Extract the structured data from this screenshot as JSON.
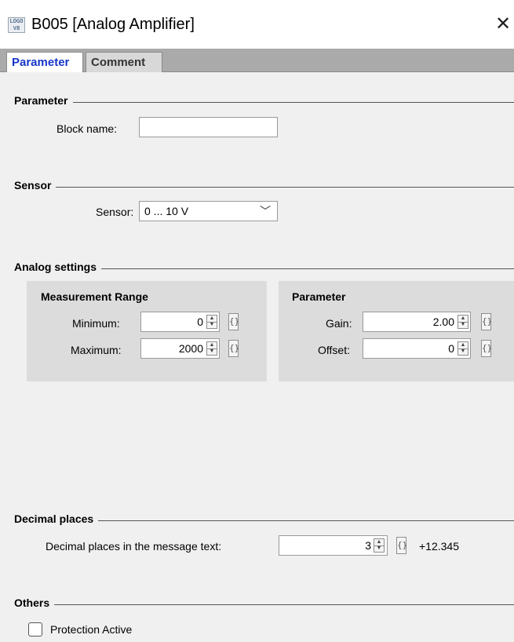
{
  "window": {
    "title": "B005 [Analog Amplifier]",
    "app_icon_text": "LOGO V8",
    "close_glyph": "✕"
  },
  "tabs": [
    {
      "label": "Parameter",
      "active": true
    },
    {
      "label": "Comment",
      "active": false
    }
  ],
  "sections": {
    "parameter": {
      "title": "Parameter",
      "block_name_label": "Block name:",
      "block_name_value": ""
    },
    "sensor": {
      "title": "Sensor",
      "sensor_label": "Sensor:",
      "sensor_value": "0 ... 10 V",
      "chevron": "﹀"
    },
    "analog_settings": {
      "title": "Analog settings",
      "measurement_range": {
        "title": "Measurement Range",
        "minimum_label": "Minimum:",
        "minimum_value": "0",
        "maximum_label": "Maximum:",
        "maximum_value": "2000"
      },
      "parameter_group": {
        "title": "Parameter",
        "gain_label": "Gain:",
        "gain_value": "2.00",
        "offset_label": "Offset:",
        "offset_value": "0"
      }
    },
    "decimal_places": {
      "title": "Decimal places",
      "label": "Decimal places in the message text:",
      "value": "3",
      "preview": "+12.345"
    },
    "others": {
      "title": "Others",
      "protection_label": "Protection Active",
      "protection_checked": false
    }
  },
  "glyphs": {
    "spin_up": "▲",
    "spin_down": "▼",
    "bracket": "{}"
  },
  "colors": {
    "active_tab_text": "#1736c9",
    "tabstrip": "#aaaaaa",
    "panel_bg": "#f0f0f0",
    "group_bg": "#dcdcdc"
  }
}
